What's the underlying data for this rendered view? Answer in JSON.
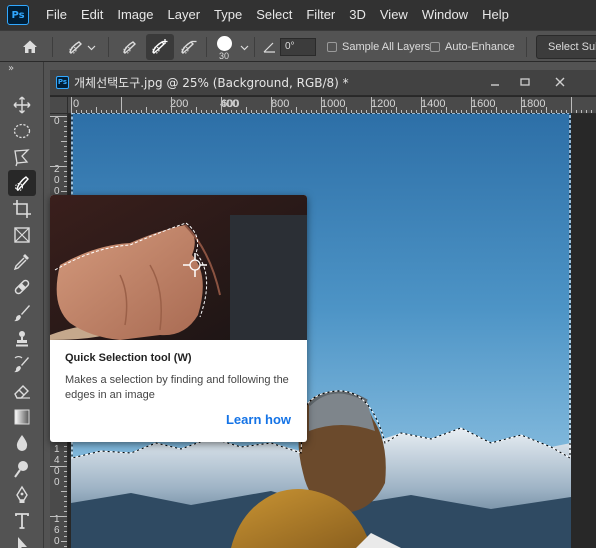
{
  "menubar": {
    "logo": "Ps",
    "items": [
      "File",
      "Edit",
      "Image",
      "Layer",
      "Type",
      "Select",
      "Filter",
      "3D",
      "View",
      "Window",
      "Help"
    ]
  },
  "options": {
    "brush_size": "30",
    "angle_value": "0°",
    "sample_all_layers": "Sample All Layers",
    "auto_enhance": "Auto-Enhance",
    "select_subject": "Select Subject"
  },
  "document": {
    "ps_badge": "Ps",
    "title": "개체선택도구.jpg @ 25% (Background, RGB/8) *",
    "ruler_top": [
      "0",
      "200",
      "400",
      "600",
      "800",
      "1000",
      "1200",
      "1400",
      "1600",
      "1800"
    ],
    "ruler_left": [
      "0",
      "2 0 0",
      "1 4 0 0",
      "1 6 0 0"
    ]
  },
  "tooltip": {
    "title": "Quick Selection tool (W)",
    "description": "Makes a selection by finding and following the edges in an image",
    "link": "Learn how"
  },
  "colors": {
    "accent": "#31a8ff",
    "link": "#1473e6",
    "menubar_bg": "#323232",
    "panel_bg": "#535353"
  }
}
